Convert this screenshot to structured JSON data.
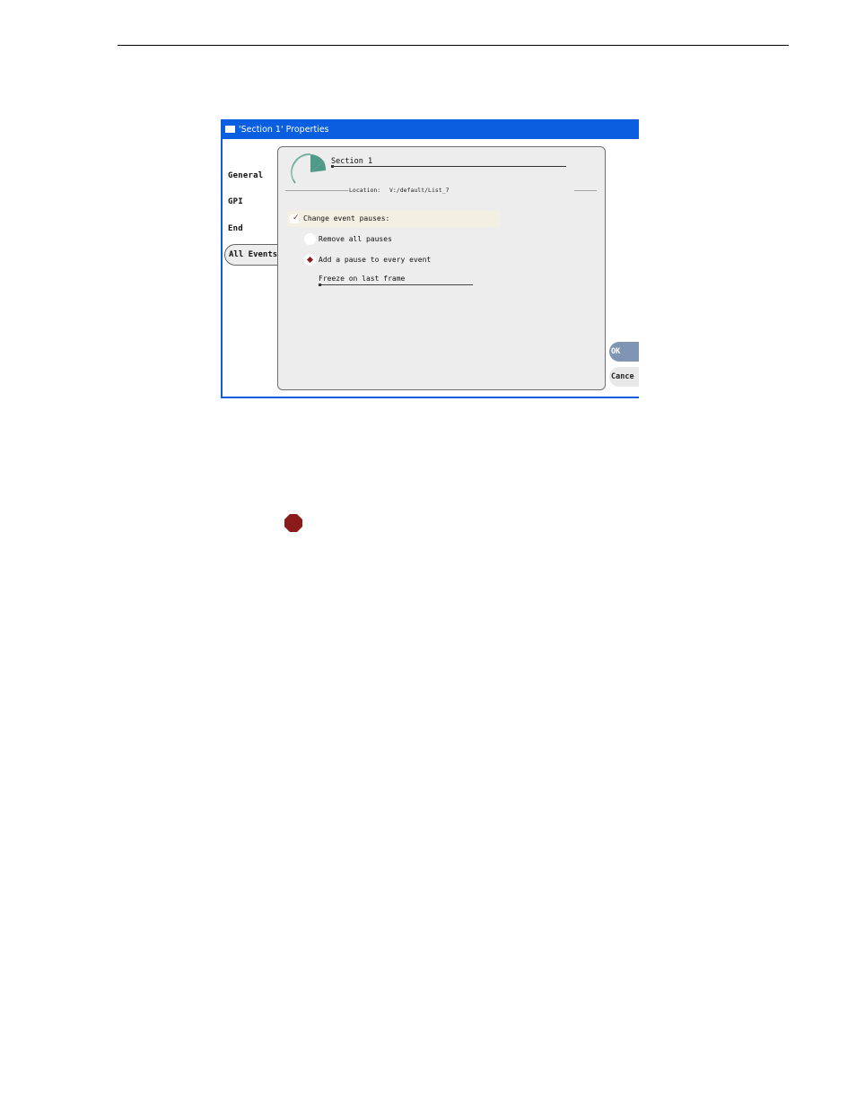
{
  "window": {
    "title": "'Section 1' Properties"
  },
  "tabs": [
    {
      "label": "General"
    },
    {
      "label": "GPI"
    },
    {
      "label": "End"
    },
    {
      "label": "All Events",
      "selected": true
    }
  ],
  "panel": {
    "section_name": "Section 1",
    "location_label": "Location:",
    "location_value": "V:/default/List_7",
    "change_event_pauses": {
      "label": "Change event pauses:",
      "checked": true
    },
    "options": [
      {
        "label": "Remove all pauses",
        "selected": false
      },
      {
        "label": "Add a pause to every event",
        "selected": true
      }
    ],
    "pause_type": {
      "value": "Freeze on last frame"
    }
  },
  "buttons": {
    "ok": "OK",
    "cancel": "Cance"
  },
  "colors": {
    "titlebar": "#0a5fe0",
    "accent": "#8b1a1a",
    "ok_button": "#7f95b3",
    "panel_bg": "#ededed",
    "pie_icon": "#4f9a89"
  },
  "icons": {
    "window": "window-icon",
    "section": "pie-section-icon",
    "note": "stop-sign-icon"
  }
}
